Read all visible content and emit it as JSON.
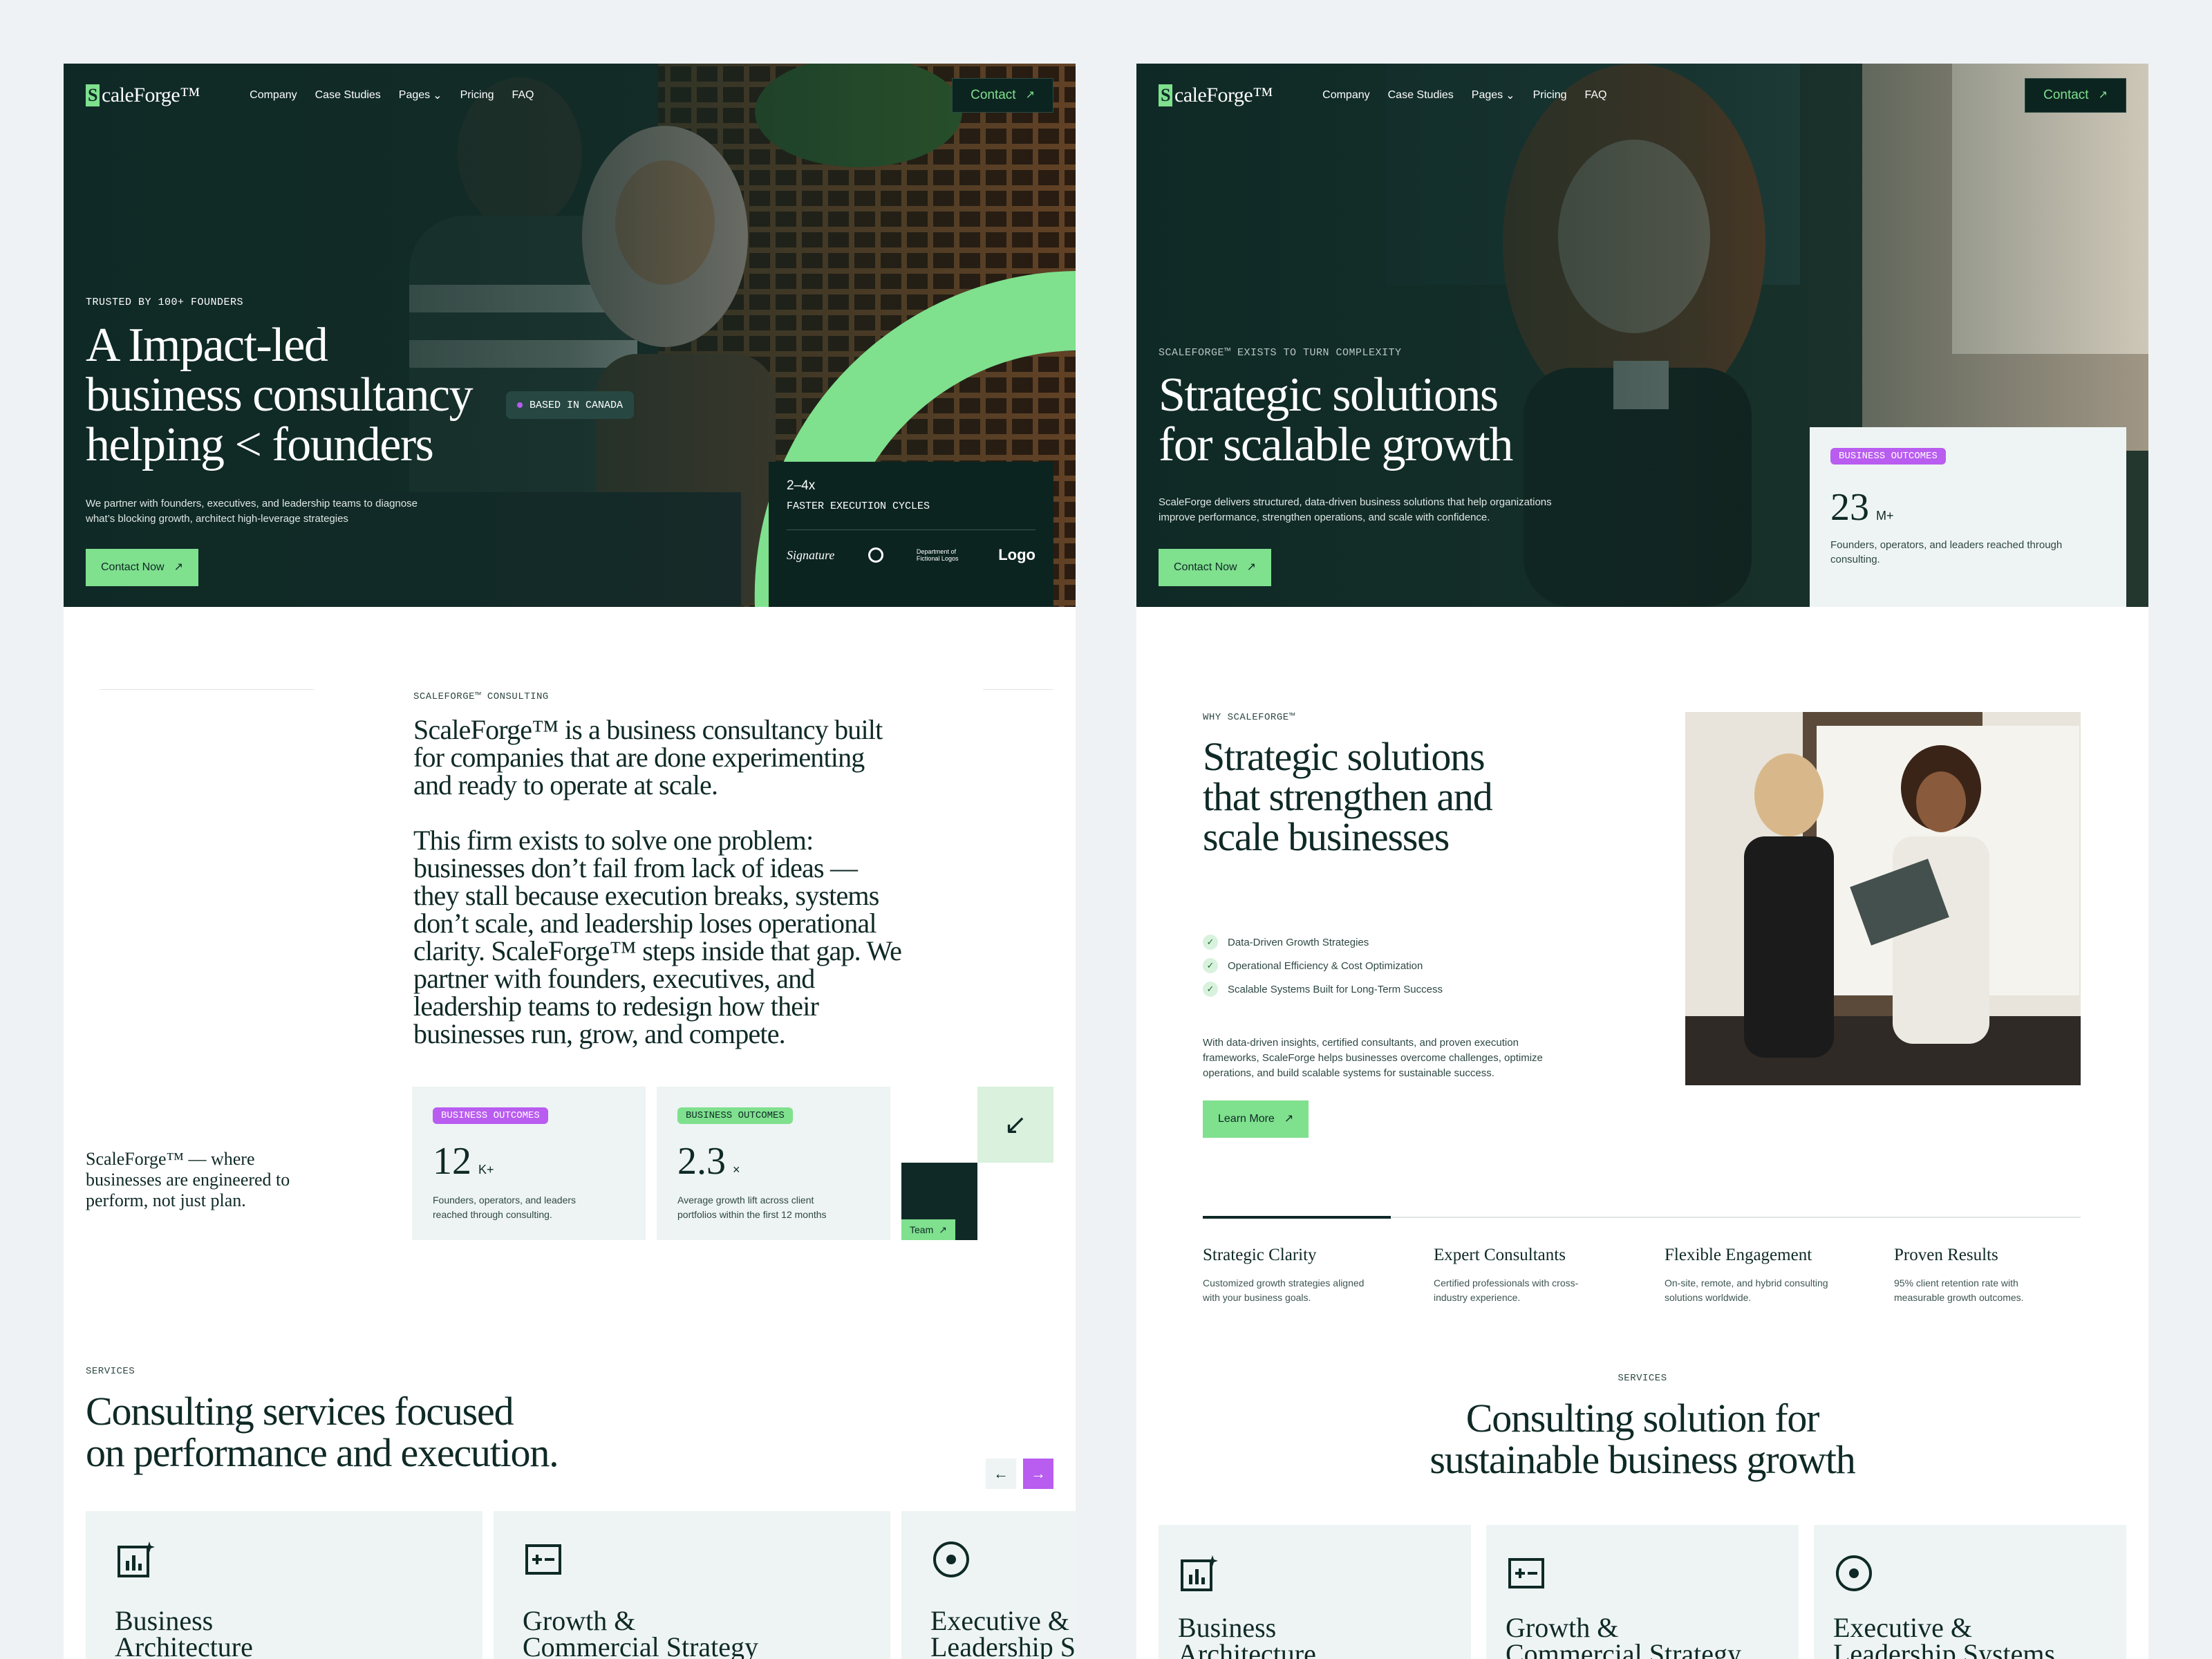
{
  "left": {
    "nav": {
      "logo_mark": "S",
      "logo_text": "caleForge™",
      "items": [
        "Company",
        "Case Studies",
        "Pages",
        "Pricing",
        "FAQ"
      ],
      "contact": "Contact"
    },
    "hero": {
      "eyebrow": "TRUSTED BY 100+ FOUNDERS",
      "title_lines": [
        "A Impact-led",
        "business consultancy",
        "helping < founders"
      ],
      "badge": "BASED IN CANADA",
      "subtitle_lines": [
        "We partner with founders, executives, and leadership teams to diagnose",
        "what’s blocking growth, architect high-leverage strategies"
      ],
      "cta": "Contact Now",
      "stat_value": "2–4x",
      "stat_label": "FASTER EXECUTION CYCLES",
      "logos": [
        "Signature",
        "Seal",
        "Department of Fictional Logos",
        "Logo"
      ]
    },
    "about": {
      "eyebrow": "SCALEFORGE™ CONSULTING",
      "lead_lines": [
        "ScaleForge™ is a business consultancy built",
        "for companies that are done experimenting",
        "and ready to operate at scale."
      ],
      "body_lines": [
        "This firm exists to solve one problem:",
        "businesses don’t fail from lack of ideas —",
        "they stall because execution breaks, systems",
        "don’t scale, and leadership loses operational",
        "clarity. ScaleForge™ steps inside that gap. We",
        "partner with founders, executives, and",
        "leadership teams to redesign how their",
        "businesses run, grow, and compete."
      ],
      "quote_lines": [
        "ScaleForge™ — where",
        "businesses are engineered to",
        "perform, not just plan."
      ],
      "stats": [
        {
          "tag": "BUSINESS OUTCOMES",
          "value": "12",
          "suffix": "K+",
          "desc_lines": [
            "Founders, operators, and leaders",
            "reached through consulting."
          ]
        },
        {
          "tag": "BUSINESS OUTCOMES",
          "value": "2.3",
          "suffix": "×",
          "desc_lines": [
            "Average growth lift across client",
            "portfolios within the first 12 months"
          ]
        }
      ],
      "team_label": "Team"
    },
    "services": {
      "eyebrow": "SERVICES",
      "title_lines": [
        "Consulting services focused",
        "on performance and execution."
      ],
      "cards": [
        {
          "icon": "chart-spark-icon",
          "title_lines": [
            "Business",
            "Architecture"
          ]
        },
        {
          "icon": "plus-minus-icon",
          "title_lines": [
            "Growth &",
            "Commercial Strategy"
          ]
        },
        {
          "icon": "target-icon",
          "title_lines": [
            "Executive &",
            "Leadership Systems"
          ]
        }
      ]
    }
  },
  "right": {
    "nav": {
      "logo_mark": "S",
      "logo_text": "caleForge™",
      "items": [
        "Company",
        "Case Studies",
        "Pages",
        "Pricing",
        "FAQ"
      ],
      "contact": "Contact"
    },
    "hero": {
      "eyebrow": "SCALEFORGE™ EXISTS TO TURN COMPLEXITY",
      "title_lines": [
        "Strategic solutions",
        "for scalable growth"
      ],
      "subtitle_lines": [
        "ScaleForge delivers structured, data-driven business solutions that help organizations",
        "improve performance, strengthen operations, and scale with confidence."
      ],
      "cta": "Contact Now",
      "card": {
        "tag": "BUSINESS OUTCOMES",
        "value": "23",
        "suffix": "M+",
        "desc_lines": [
          "Founders, operators, and leaders reached through",
          "consulting."
        ]
      }
    },
    "why": {
      "eyebrow": "WHY SCALEFORGE™",
      "title_lines": [
        "Strategic solutions",
        "that strengthen and",
        "scale businesses"
      ],
      "checks": [
        "Data-Driven Growth Strategies",
        "Operational Efficiency & Cost Optimization",
        "Scalable Systems Built for Long-Term Success"
      ],
      "body_lines": [
        "With data-driven insights, certified consultants, and proven execution",
        "frameworks, ScaleForge helps businesses overcome challenges, optimize",
        "operations, and build scalable systems for sustainable success."
      ],
      "cta": "Learn More"
    },
    "features": [
      {
        "title": "Strategic Clarity",
        "desc_lines": [
          "Customized growth strategies aligned",
          "with your business goals."
        ]
      },
      {
        "title": "Expert Consultants",
        "desc_lines": [
          "Certified professionals with cross-",
          "industry experience."
        ]
      },
      {
        "title": "Flexible Engagement",
        "desc_lines": [
          "On-site, remote, and hybrid consulting",
          "solutions worldwide."
        ]
      },
      {
        "title": "Proven Results",
        "desc_lines": [
          "95% client retention rate with",
          "measurable growth outcomes."
        ]
      }
    ],
    "services": {
      "eyebrow": "SERVICES",
      "title_lines": [
        "Consulting solution for",
        "sustainable business growth"
      ],
      "cards": [
        {
          "icon": "chart-spark-icon",
          "title_lines": [
            "Business",
            "Architecture"
          ]
        },
        {
          "icon": "plus-minus-icon",
          "title_lines": [
            "Growth &",
            "Commercial Strategy"
          ]
        },
        {
          "icon": "target-icon",
          "title_lines": [
            "Executive &",
            "Leadership Systems"
          ]
        }
      ]
    }
  },
  "colors": {
    "dark": "#0f2a26",
    "green": "#7fe08e",
    "purple": "#b95cf0",
    "card": "#eef4f4",
    "bg": "#eff2f5"
  }
}
